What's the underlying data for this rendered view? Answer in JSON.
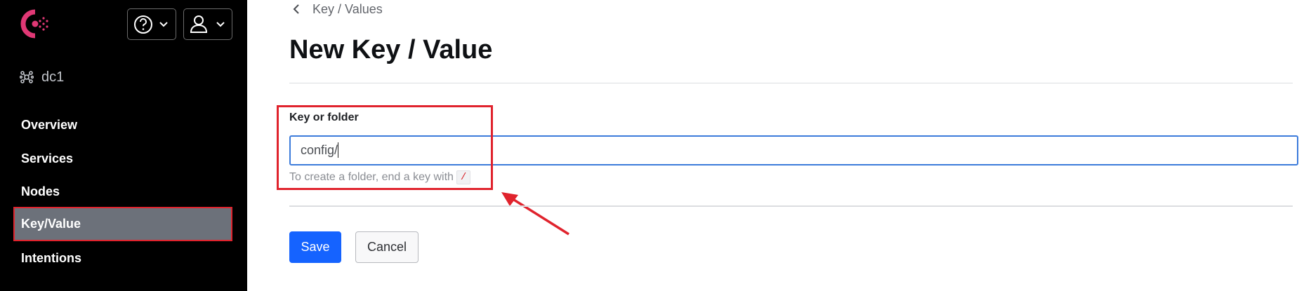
{
  "sidebar": {
    "logo": "consul-logo-icon",
    "help_menu": {
      "icon": "help-circle-icon",
      "caret": "chevron-down-icon"
    },
    "user_menu": {
      "icon": "user-icon",
      "caret": "chevron-down-icon"
    },
    "datacenter": {
      "icon": "datacenter-icon",
      "label": "dc1"
    },
    "nav": [
      {
        "label": "Overview",
        "active": false
      },
      {
        "label": "Services",
        "active": false
      },
      {
        "label": "Nodes",
        "active": false
      },
      {
        "label": "Key/Value",
        "active": true
      },
      {
        "label": "Intentions",
        "active": false
      }
    ]
  },
  "main": {
    "breadcrumb": {
      "icon": "chevron-left-icon",
      "label": "Key / Values"
    },
    "title": "New Key / Value",
    "form": {
      "field_label": "Key or folder",
      "field_value": "config/",
      "help_text": "To create a folder, end a key with",
      "help_code": "/"
    },
    "actions": {
      "save_label": "Save",
      "cancel_label": "Cancel"
    }
  },
  "colors": {
    "sidebar_bg": "#000000",
    "active_nav_bg": "#6c717a",
    "primary": "#1563ff",
    "input_focus": "#3c7bdb",
    "annotation_red": "#e0232d",
    "logo_pink": "#e03875"
  }
}
